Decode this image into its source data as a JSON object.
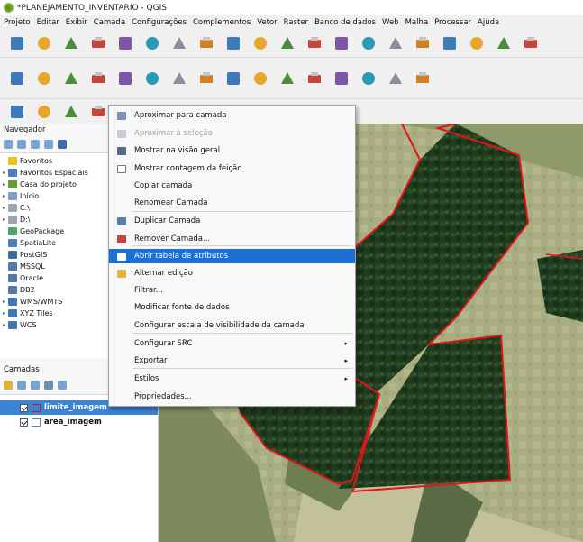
{
  "window": {
    "title": "*PLANEJAMENTO_INVENTARIO - QGIS"
  },
  "menubar": [
    "Projeto",
    "Editar",
    "Exibir",
    "Camada",
    "Configurações",
    "Complementos",
    "Vetor",
    "Raster",
    "Banco de dados",
    "Web",
    "Malha",
    "Processar",
    "Ajuda"
  ],
  "toolbar1": [
    "new-project-icon",
    "open-project-icon",
    "save-project-icon",
    "new-print-layout-icon",
    "layout-manager-icon",
    "style-manager-icon",
    "pan-icon",
    "pan-to-selection-icon",
    "zoom-in-icon",
    "zoom-out-icon",
    "zoom-full-icon",
    "zoom-selection-icon",
    "zoom-layer-icon",
    "zoom-native-icon",
    "zoom-last-icon",
    "zoom-next-icon",
    "new-map-view-icon",
    "temporal-icon",
    "refresh-icon",
    "identify-icon"
  ],
  "toolbar2": [
    "digitizing-icon",
    "data-source-manager-icon",
    "new-shapefile-icon",
    "digitize-line-icon",
    "vertex-tool-icon",
    "add-feature-icon",
    "toggle-edit-icon",
    "pencil-icon",
    "save-edits-icon",
    "cut-icon",
    "copy-icon",
    "paste-icon",
    "delete-icon",
    "undo-icon",
    "redo-icon",
    "label-icon"
  ],
  "toolbar3": [
    "label-icon",
    "label-pin-icon",
    "label-show-icon",
    "label-move-icon",
    "label-rotate-icon",
    "label-change-icon"
  ],
  "navigator": {
    "title": "Navegador",
    "items": [
      {
        "label": "Favoritos",
        "expand": "",
        "color": "#f2c21b"
      },
      {
        "label": "Favoritos Espaciais",
        "expand": "▸",
        "color": "#4a7fc1"
      },
      {
        "label": "Casa do projeto",
        "expand": "▸",
        "color": "#6a9c36"
      },
      {
        "label": "Início",
        "expand": "▸",
        "color": "#7fa0c8"
      },
      {
        "label": "C:\\",
        "expand": "▸",
        "color": "#9aa6b2"
      },
      {
        "label": "D:\\",
        "expand": "▸",
        "color": "#9aa6b2"
      },
      {
        "label": "GeoPackage",
        "expand": "",
        "color": "#4da56a"
      },
      {
        "label": "SpatiaLite",
        "expand": "",
        "color": "#4a7fc1"
      },
      {
        "label": "PostGIS",
        "expand": "",
        "color": "#3b6ea5"
      },
      {
        "label": "MSSQL",
        "expand": "",
        "color": "#5577aa"
      },
      {
        "label": "Oracle",
        "expand": "",
        "color": "#5577aa"
      },
      {
        "label": "DB2",
        "expand": "",
        "color": "#5577aa"
      },
      {
        "label": "WMS/WMTS",
        "expand": "▸",
        "color": "#3c77b8"
      },
      {
        "label": "XYZ Tiles",
        "expand": "▸",
        "color": "#3c77b8"
      },
      {
        "label": "WCS",
        "expand": "▸",
        "color": "#3c77b8"
      }
    ]
  },
  "layers": {
    "title": "Camadas",
    "items": [
      {
        "label": "limite_imagem",
        "selected": true,
        "color": "#c21f1f"
      },
      {
        "label": "area_imagem",
        "selected": false,
        "color": "#6a7f8c"
      }
    ]
  },
  "context_menu": {
    "items": [
      {
        "label": "Aproximar para camada",
        "disabled": false,
        "highlight": false,
        "submenu": false,
        "icon": "zoom-to-layer-icon",
        "color": "#7d93b5"
      },
      {
        "label": "Aproximar à seleção",
        "disabled": true,
        "highlight": false,
        "submenu": false,
        "icon": "zoom-to-selection-icon",
        "color": "#c9cdd3"
      },
      {
        "label": "Mostrar na visão geral",
        "disabled": false,
        "highlight": false,
        "submenu": false,
        "icon": "overview-icon",
        "color": "#556a88"
      },
      {
        "label": "Mostrar contagem da feição",
        "disabled": false,
        "highlight": false,
        "submenu": false,
        "icon": "checkbox-icon",
        "color": ""
      },
      {
        "label": "Copiar camada",
        "disabled": false,
        "highlight": false,
        "submenu": false,
        "icon": "",
        "color": ""
      },
      {
        "label": "Renomear Camada",
        "disabled": false,
        "highlight": false,
        "submenu": false,
        "icon": "",
        "color": ""
      },
      {
        "label": "Duplicar Camada",
        "disabled": false,
        "highlight": false,
        "submenu": false,
        "icon": "duplicate-icon",
        "color": "#5b7ea6"
      },
      {
        "label": "Remover Camada...",
        "disabled": false,
        "highlight": false,
        "submenu": false,
        "icon": "remove-layer-icon",
        "color": "#c0453c"
      },
      {
        "label": "Abrir tabela de atributos",
        "disabled": false,
        "highlight": true,
        "submenu": false,
        "icon": "attribute-table-icon",
        "color": "#ffffff"
      },
      {
        "label": "Alternar edição",
        "disabled": false,
        "highlight": false,
        "submenu": false,
        "icon": "pencil-icon",
        "color": "#e5b23a"
      },
      {
        "label": "Filtrar...",
        "disabled": false,
        "highlight": false,
        "submenu": false,
        "icon": "",
        "color": ""
      },
      {
        "label": "Modificar fonte de dados",
        "disabled": false,
        "highlight": false,
        "submenu": false,
        "icon": "",
        "color": ""
      },
      {
        "label": "Configurar escala de visibilidade da camada",
        "disabled": false,
        "highlight": false,
        "submenu": false,
        "icon": "",
        "color": ""
      },
      {
        "label": "Configurar SRC",
        "disabled": false,
        "highlight": false,
        "submenu": true,
        "icon": "",
        "color": ""
      },
      {
        "label": "Exportar",
        "disabled": false,
        "highlight": false,
        "submenu": true,
        "icon": "",
        "color": ""
      },
      {
        "label": "Estilos",
        "disabled": false,
        "highlight": false,
        "submenu": true,
        "icon": "",
        "color": ""
      },
      {
        "label": "Propriedades...",
        "disabled": false,
        "highlight": false,
        "submenu": false,
        "icon": "",
        "color": ""
      }
    ]
  },
  "colors": {
    "accent": "#1c6fd3",
    "polygon_outline": "#e0161b",
    "forest": "#1f3a1c",
    "field": "#a5ad7e"
  }
}
